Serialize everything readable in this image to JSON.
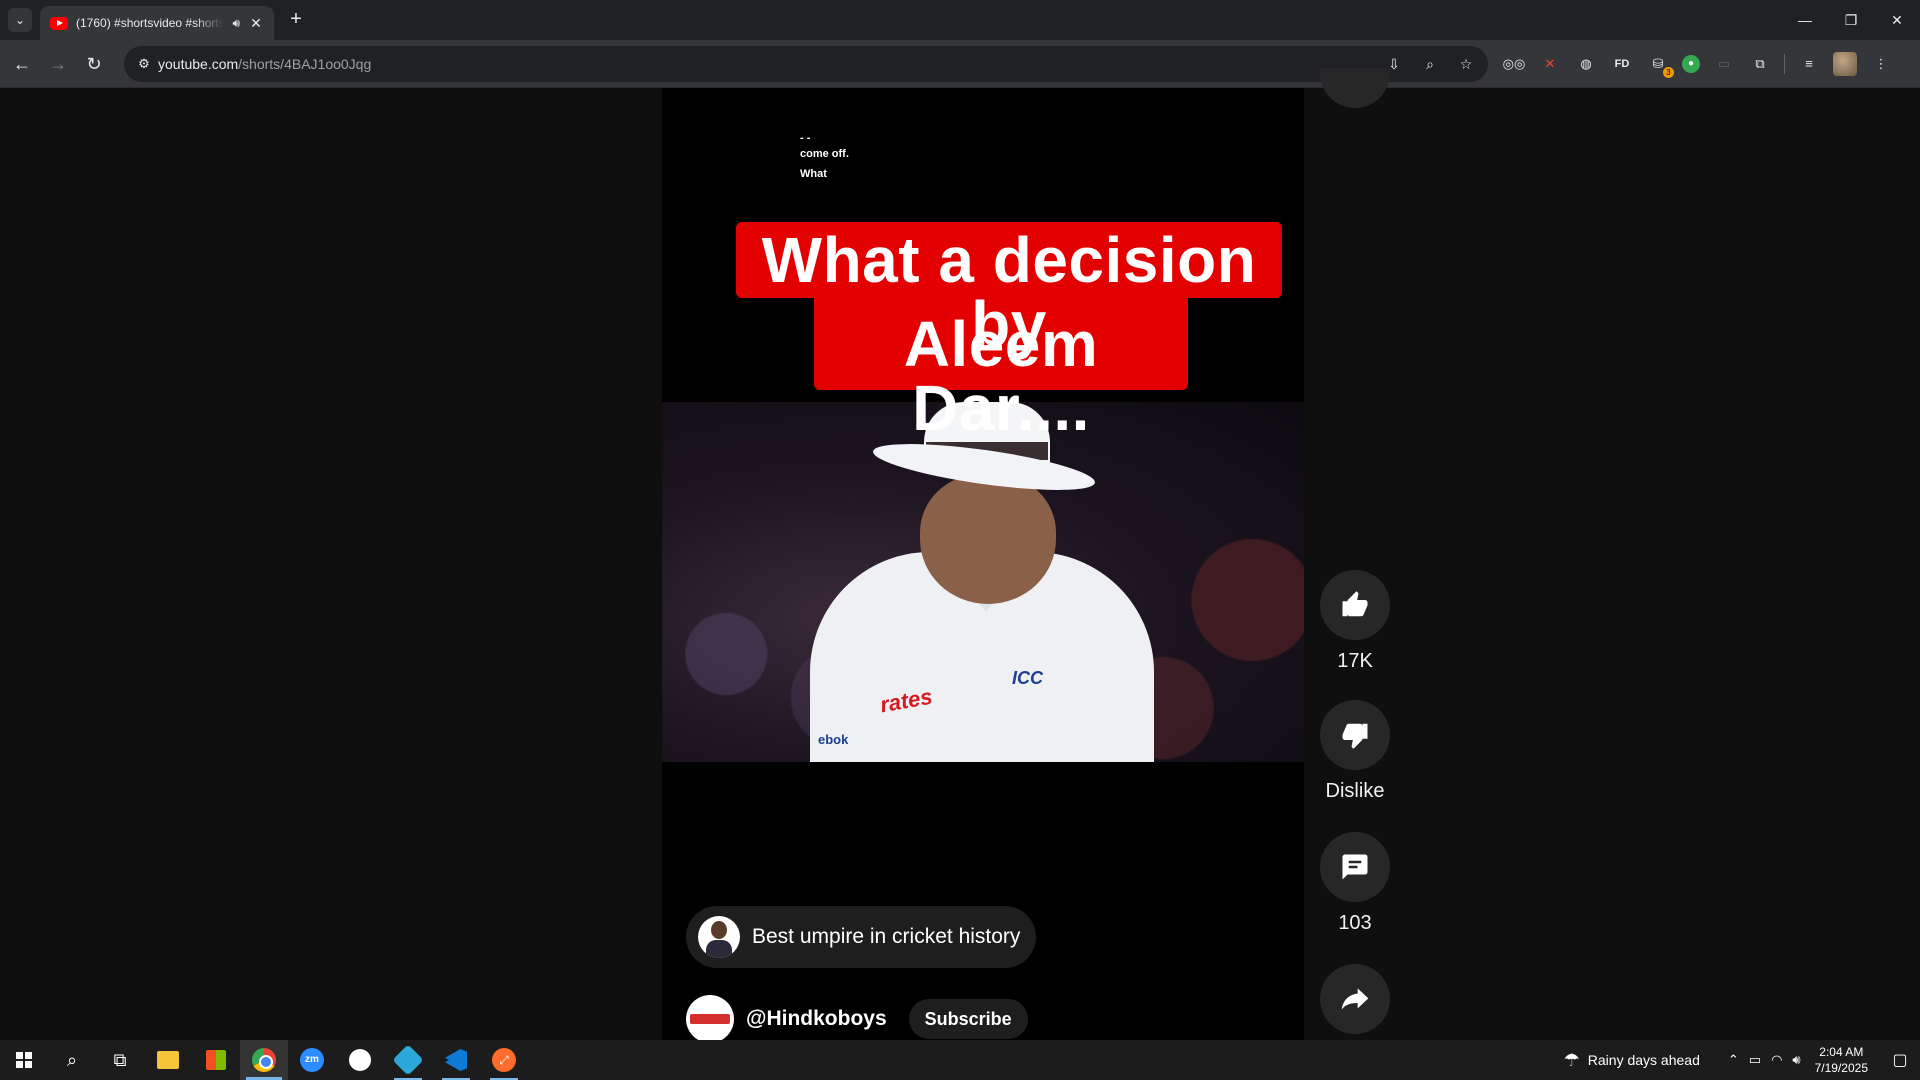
{
  "browser": {
    "tab_title": "(1760) #shortsvideo #shorts",
    "url_host": "youtube.com",
    "url_path": "/shorts/4BAJ1oo0Jqg"
  },
  "video": {
    "caption_top_1": "- -",
    "caption_top_2": "come off.",
    "caption_top_3": "What",
    "banner_line_1": "What a decision by",
    "banner_line_2": "Aleem Dar....",
    "shirt_logo_icc": "ICC",
    "shirt_logo_sponsor": "rates",
    "shirt_logo_brand": "ebok"
  },
  "actions": {
    "like_count": "17K",
    "dislike_label": "Dislike",
    "comment_count": "103"
  },
  "overlay": {
    "video_title": "Best umpire in cricket history",
    "channel_name": "@Hindkoboys",
    "subscribe_label": "Subscribe"
  },
  "taskbar": {
    "weather_text": "Rainy days ahead",
    "time": "2:04 AM",
    "date": "7/19/2025"
  },
  "colors": {
    "banner_red": "#e30000",
    "page_bg": "#0f0f0f",
    "button_bg": "#272727"
  },
  "icons": [
    "tab-search-icon",
    "youtube-favicon-icon",
    "audio-icon",
    "close-icon",
    "plus-icon",
    "back-icon",
    "forward-icon",
    "reload-icon",
    "site-info-icon",
    "install-icon",
    "zoom-icon",
    "star-icon",
    "extensions-icon",
    "like-icon",
    "dislike-icon",
    "comment-icon",
    "share-icon",
    "windows-icon",
    "search-icon",
    "task-view-icon"
  ]
}
